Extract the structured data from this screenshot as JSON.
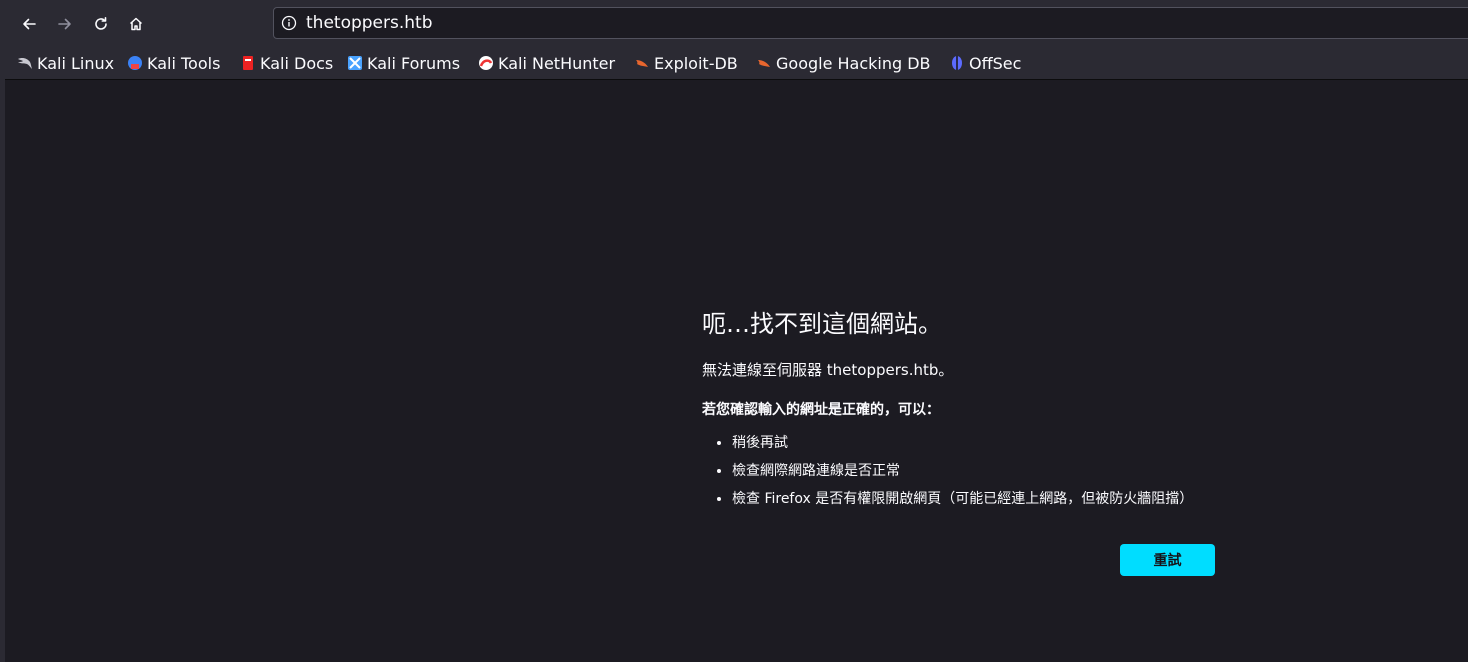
{
  "toolbar": {
    "back_icon": "arrow-left-icon",
    "forward_icon": "arrow-right-icon",
    "reload_icon": "reload-icon",
    "home_icon": "home-icon"
  },
  "urlbar": {
    "url": "thetoppers.htb",
    "security_icon": "info-icon"
  },
  "bookmarks": [
    {
      "label": "Kali Linux",
      "icon": "kali-dragon-icon",
      "color": "#9aa0a6"
    },
    {
      "label": "Kali Tools",
      "icon": "kali-tools-icon",
      "color": "#e44"
    },
    {
      "label": "Kali Docs",
      "icon": "kali-docs-icon",
      "color": "#e22"
    },
    {
      "label": "Kali Forums",
      "icon": "kali-forums-icon",
      "color": "#4aa3ff"
    },
    {
      "label": "Kali NetHunter",
      "icon": "kali-nethunter-icon",
      "color": "#e33"
    },
    {
      "label": "Exploit-DB",
      "icon": "exploit-db-icon",
      "color": "#e8662e"
    },
    {
      "label": "Google Hacking DB",
      "icon": "ghdb-icon",
      "color": "#e8662e"
    },
    {
      "label": "OffSec",
      "icon": "offsec-icon",
      "color": "#5c6bff"
    }
  ],
  "error": {
    "title": "呃…找不到這個網站。",
    "description": "無法連線至伺服器 thetoppers.htb。",
    "check_heading": "若您確認輸入的網址是正確的，可以：",
    "suggestions": [
      "稍後再試",
      "檢查網際網路連線是否正常",
      "檢查 Firefox 是否有權限開啟網頁（可能已經連上網路，但被防火牆阻擋）"
    ],
    "retry_label": "重試"
  },
  "colors": {
    "chrome_bg": "#2b2a33",
    "page_bg": "#1c1b22",
    "accent": "#00ddff"
  }
}
